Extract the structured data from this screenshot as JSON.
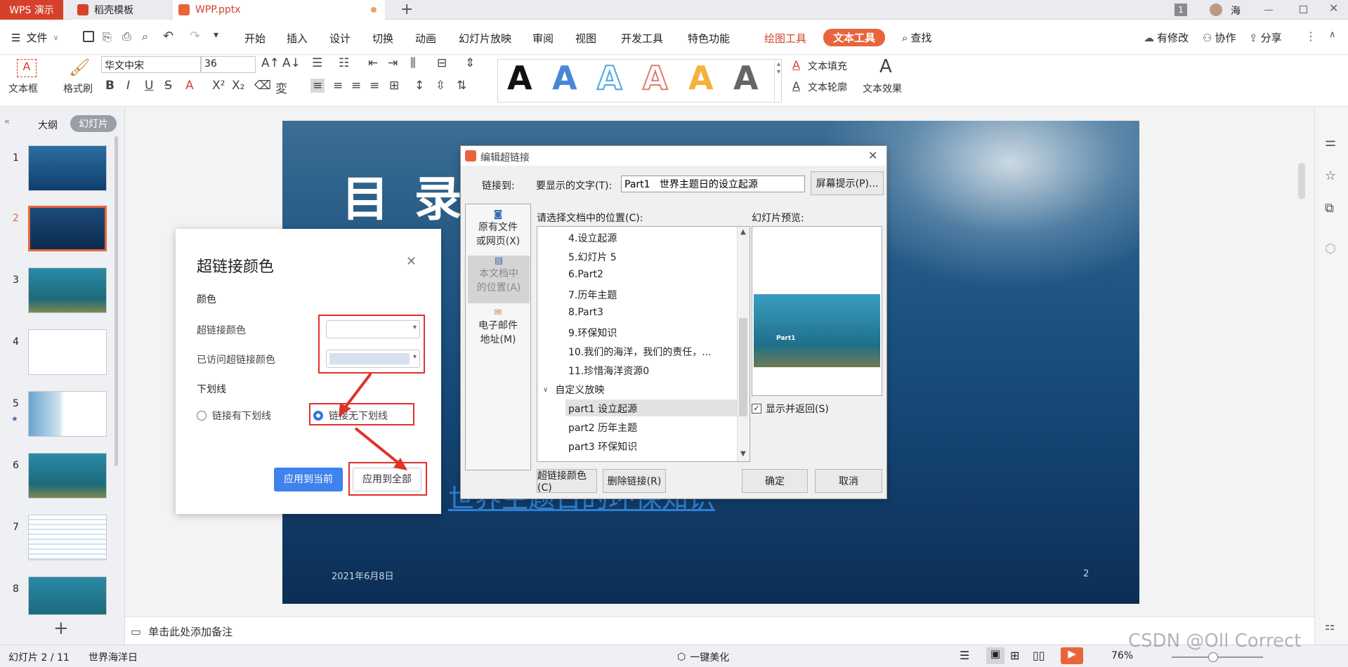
{
  "tabs": {
    "wps": "WPS 演示",
    "daoke": "稻壳模板",
    "file": "WPP.pptx",
    "new_tab": "+"
  },
  "window": {
    "page_count": "1",
    "user": "海"
  },
  "menu": {
    "file": "文件",
    "items": [
      "开始",
      "插入",
      "设计",
      "切换",
      "动画",
      "幻灯片放映",
      "审阅",
      "视图",
      "开发工具",
      "特色功能"
    ],
    "draw_tool": "绘图工具",
    "text_tool": "文本工具",
    "search": "查找",
    "modified": "有修改",
    "collab": "协作",
    "share": "分享"
  },
  "ribbon": {
    "textbox": "文本框",
    "format_brush": "格式刷",
    "font": "华文中宋",
    "size": "36",
    "fill": "文本填充",
    "outline": "文本轮廓",
    "effect": "文本效果"
  },
  "left_panel": {
    "outline_tab": "大纲",
    "slides_tab": "幻灯片",
    "slides": [
      "1",
      "2",
      "3",
      "4",
      "5",
      "6",
      "7",
      "8"
    ],
    "star": "★"
  },
  "slide": {
    "title": "目 录",
    "link_text": "世界主题日的环保知识",
    "date": "2021年6月8日",
    "page": "2"
  },
  "color_dialog": {
    "title": "超链接颜色",
    "section_color": "颜色",
    "link_color_label": "超链接颜色",
    "visited_color_label": "已访问超链接颜色",
    "section_underline": "下划线",
    "radio_underline": "链接有下划线",
    "radio_no_underline": "链接无下划线",
    "apply_current": "应用到当前",
    "apply_all": "应用到全部"
  },
  "hyper_dialog": {
    "title": "编辑超链接",
    "link_to": "链接到:",
    "display_text_label": "要显示的文字(T):",
    "display_text_value": "Part1   世界主题日的设立起源",
    "screen_tip": "屏幕提示(P)...",
    "nav": [
      {
        "line1": "原有文件",
        "line2": "或网页(X)"
      },
      {
        "line1": "本文档中",
        "line2": "的位置(A)"
      },
      {
        "line1": "电子邮件",
        "line2": "地址(M)"
      }
    ],
    "list_label": "请选择文档中的位置(C):",
    "items": [
      "4.设立起源",
      "5.幻灯片 5",
      "6.Part2",
      "7.历年主题",
      "8.Part3",
      "9.环保知识",
      "10.我们的海洋，我们的责任，...",
      "11.珍惜海洋资源0"
    ],
    "group": "自定义放映",
    "group_items": [
      "part1 设立起源",
      "part2 历年主题",
      "part3 环保知识"
    ],
    "preview_label": "幻灯片预览:",
    "preview_text": "Part1",
    "show_return": "显示并返回(S)",
    "link_color_btn": "超链接颜色(C)",
    "remove_link_btn": "删除链接(R)",
    "ok": "确定",
    "cancel": "取消"
  },
  "notes": {
    "placeholder": "单击此处添加备注"
  },
  "status": {
    "slide_info": "幻灯片 2 / 11",
    "theme": "世界海洋日",
    "beautify": "一键美化",
    "zoom": "76%",
    "watermark": "CSDN @Oll Correct"
  }
}
